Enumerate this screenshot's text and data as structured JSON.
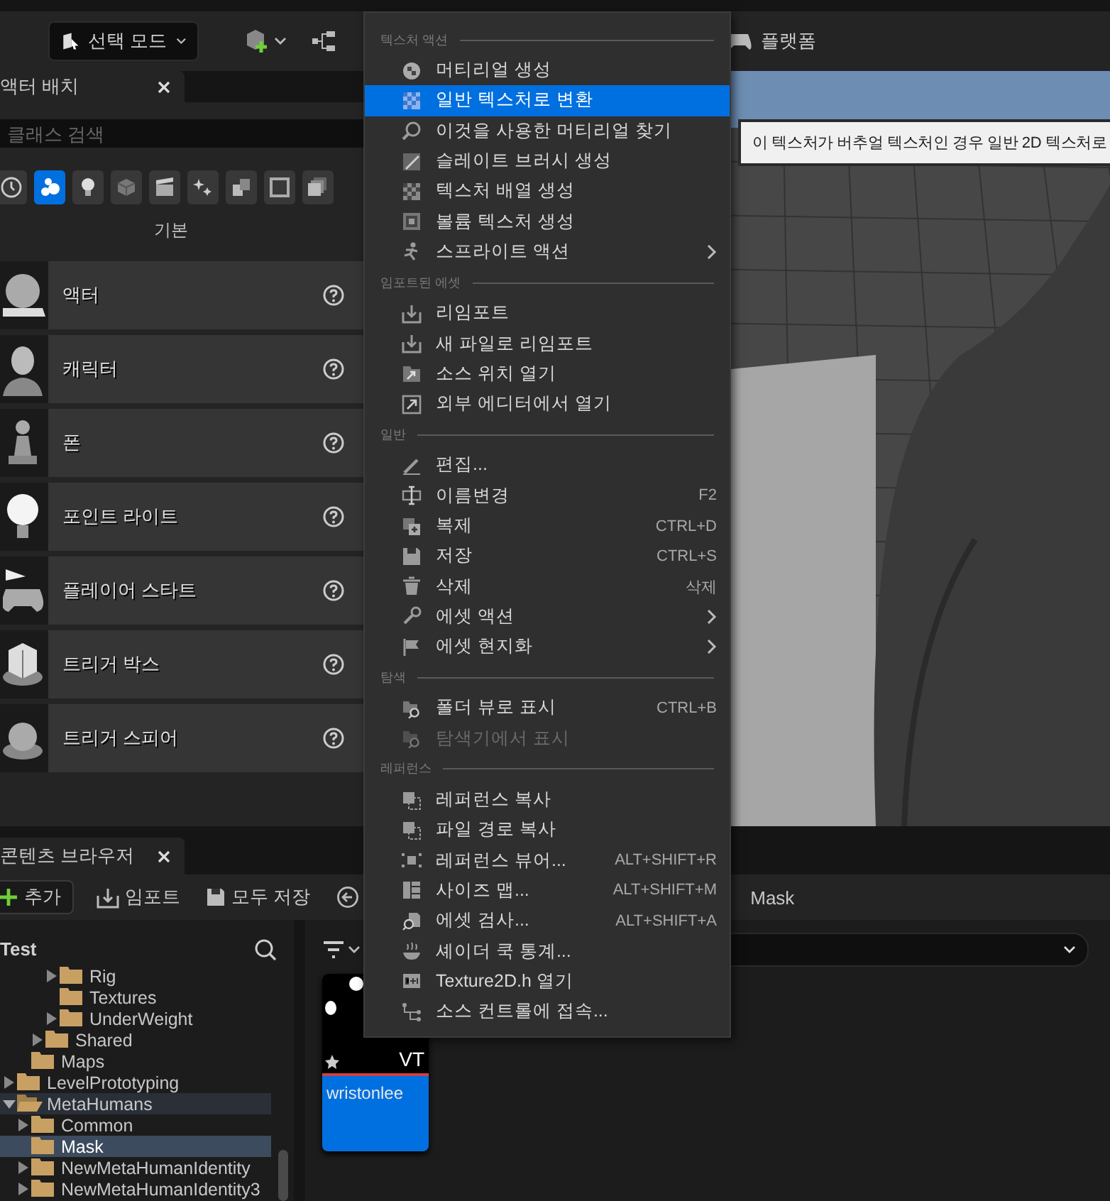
{
  "toolbar": {
    "mode_button": "선택 모드",
    "platform_button": "플랫폼"
  },
  "place_actors": {
    "tab": "액터 배치",
    "search": {
      "placeholder": "클래스 검색"
    },
    "categories": [
      {
        "selected": false
      },
      {
        "selected": true
      },
      {
        "selected": false
      },
      {
        "selected": false
      },
      {
        "selected": false
      },
      {
        "selected": false
      },
      {
        "selected": false
      },
      {
        "selected": false
      },
      {
        "selected": false
      }
    ],
    "section": "기본",
    "actors": [
      {
        "label": "액터"
      },
      {
        "label": "캐릭터"
      },
      {
        "label": "폰"
      },
      {
        "label": "포인트 라이트"
      },
      {
        "label": "플레이어 스타트"
      },
      {
        "label": "트리거 박스"
      },
      {
        "label": "트리거 스피어"
      }
    ]
  },
  "viewport": {
    "tooltip": "이 텍스처가 버추얼 텍스처인 경우 일반 2D 텍스처로"
  },
  "context_menu": {
    "sections": [
      {
        "title": "텍스처 액션",
        "items": [
          {
            "label": "머티리얼 생성",
            "submenu": false,
            "disabled": false,
            "selected": false
          },
          {
            "label": "일반 텍스처로 변환",
            "submenu": false,
            "disabled": false,
            "selected": true
          },
          {
            "label": "이것을 사용한 머티리얼 찾기",
            "submenu": false,
            "disabled": false,
            "selected": false
          },
          {
            "label": "슬레이트 브러시 생성",
            "submenu": false,
            "disabled": false,
            "selected": false
          },
          {
            "label": "텍스처 배열 생성",
            "submenu": false,
            "disabled": false,
            "selected": false
          },
          {
            "label": "볼륨 텍스처 생성",
            "submenu": false,
            "disabled": false,
            "selected": false
          },
          {
            "label": "스프라이트 액션",
            "submenu": true,
            "disabled": false,
            "selected": false
          }
        ]
      },
      {
        "title": "임포트된 에셋",
        "items": [
          {
            "label": "리임포트",
            "submenu": false,
            "disabled": false,
            "selected": false
          },
          {
            "label": "새 파일로 리임포트",
            "submenu": false,
            "disabled": false,
            "selected": false
          },
          {
            "label": "소스 위치 열기",
            "submenu": false,
            "disabled": false,
            "selected": false
          },
          {
            "label": "외부 에디터에서 열기",
            "submenu": false,
            "disabled": false,
            "selected": false
          }
        ]
      },
      {
        "title": "일반",
        "items": [
          {
            "label": "편집...",
            "submenu": false,
            "disabled": false,
            "selected": false
          },
          {
            "label": "이름변경",
            "shortcut": "F2",
            "submenu": false,
            "disabled": false,
            "selected": false
          },
          {
            "label": "복제",
            "shortcut": "CTRL+D",
            "submenu": false,
            "disabled": false,
            "selected": false
          },
          {
            "label": "저장",
            "shortcut": "CTRL+S",
            "submenu": false,
            "disabled": false,
            "selected": false
          },
          {
            "label": "삭제",
            "shortcut": "삭제",
            "submenu": false,
            "disabled": false,
            "selected": false
          },
          {
            "label": "에셋 액션",
            "submenu": true,
            "disabled": false,
            "selected": false
          },
          {
            "label": "에셋 현지화",
            "submenu": true,
            "disabled": false,
            "selected": false
          }
        ]
      },
      {
        "title": "탐색",
        "items": [
          {
            "label": "폴더 뷰로 표시",
            "shortcut": "CTRL+B",
            "submenu": false,
            "disabled": false,
            "selected": false
          },
          {
            "label": "탐색기에서 표시",
            "submenu": false,
            "disabled": true,
            "selected": false
          }
        ]
      },
      {
        "title": "레퍼런스",
        "items": [
          {
            "label": "레퍼런스 복사",
            "submenu": false,
            "disabled": false,
            "selected": false
          },
          {
            "label": "파일 경로 복사",
            "submenu": false,
            "disabled": false,
            "selected": false
          },
          {
            "label": "레퍼런스 뷰어...",
            "shortcut": "ALT+SHIFT+R",
            "submenu": false,
            "disabled": false,
            "selected": false
          },
          {
            "label": "사이즈 맵...",
            "shortcut": "ALT+SHIFT+M",
            "submenu": false,
            "disabled": false,
            "selected": false
          },
          {
            "label": "에셋 검사...",
            "shortcut": "ALT+SHIFT+A",
            "submenu": false,
            "disabled": false,
            "selected": false
          },
          {
            "label": "셰이더 쿡 통계...",
            "submenu": false,
            "disabled": false,
            "selected": false
          },
          {
            "label": "Texture2D.h 열기",
            "submenu": false,
            "disabled": false,
            "selected": false
          },
          {
            "label": "소스 컨트롤에 접속...",
            "submenu": false,
            "disabled": false,
            "selected": false
          }
        ]
      }
    ]
  },
  "content_browser": {
    "tab": "콘텐츠 브라우저",
    "toolbar": [
      {
        "kind": "add",
        "label": "추가"
      },
      {
        "kind": "import",
        "label": "임포트"
      },
      {
        "kind": "save_all",
        "label": "모두 저장"
      }
    ],
    "breadcrumb": "Mask",
    "tree_title": "Test",
    "tree": [
      {
        "children": [
          {
            "children": [
              {
                "children": [
                  {
                    "label": "Rig",
                    "expanded": false,
                    "selected": false,
                    "highlighted": false
                  },
                  {
                    "label": "Textures",
                    "selected": false,
                    "highlighted": false
                  },
                  {
                    "label": "UnderWeight",
                    "expanded": false,
                    "selected": false,
                    "highlighted": false
                  }
                ]
              },
              {
                "label": "Shared",
                "expanded": false,
                "selected": false,
                "highlighted": false
              }
            ]
          },
          {
            "label": "Maps",
            "selected": false,
            "highlighted": false
          }
        ]
      },
      {
        "label": "LevelPrototyping",
        "expanded": false,
        "selected": false,
        "highlighted": false
      },
      {
        "label": "MetaHumans",
        "expanded": true,
        "selected": false,
        "highlighted": true,
        "children": [
          {
            "label": "Common",
            "expanded": false,
            "selected": false,
            "highlighted": false
          },
          {
            "label": "Mask",
            "selected": true,
            "highlighted": false
          },
          {
            "label": "NewMetaHumanIdentity",
            "expanded": false,
            "selected": false,
            "highlighted": false
          },
          {
            "label": "NewMetaHumanIdentity3",
            "expanded": false,
            "selected": false,
            "highlighted": false
          }
        ]
      }
    ],
    "assets": [
      {
        "name": "wristonlee",
        "badge": "VT",
        "selected": true
      }
    ]
  }
}
